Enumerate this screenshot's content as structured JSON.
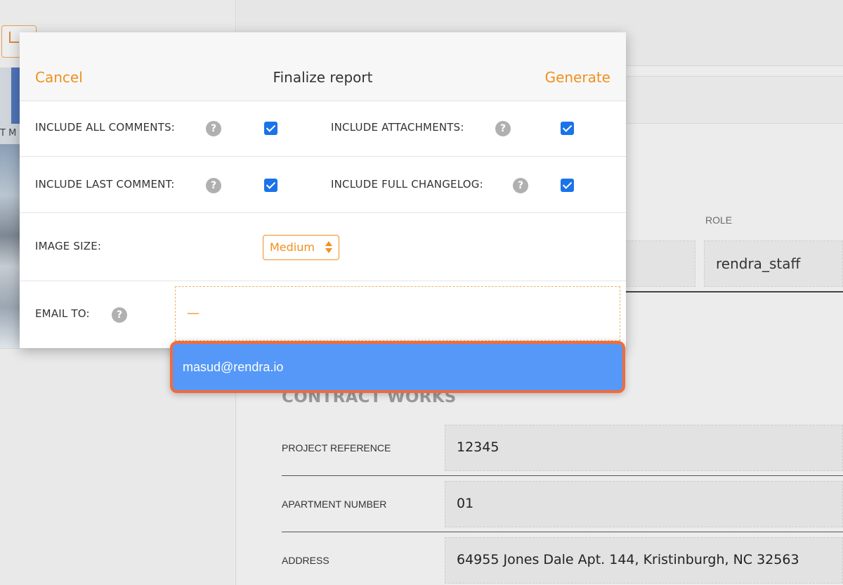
{
  "background": {
    "thumb_caption": "T M",
    "role": {
      "label": "ROLE",
      "value": "rendra_staff"
    },
    "section_title": "CONTRACT WORKS",
    "rows": [
      {
        "label": "PROJECT REFERENCE",
        "value": "12345"
      },
      {
        "label": "APARTMENT NUMBER",
        "value": "01"
      },
      {
        "label": "ADDRESS",
        "value": "64955 Jones Dale Apt. 144, Kristinburgh, NC 32563"
      }
    ]
  },
  "modal": {
    "title": "Finalize report",
    "cancel_label": "Cancel",
    "generate_label": "Generate",
    "options": {
      "include_all_comments": {
        "label": "INCLUDE ALL COMMENTS:",
        "checked": true
      },
      "include_attachments": {
        "label": "INCLUDE ATTACHMENTS:",
        "checked": true
      },
      "include_last_comment": {
        "label": "INCLUDE LAST COMMENT:",
        "checked": true
      },
      "include_full_changelog": {
        "label": "INCLUDE FULL CHANGELOG:",
        "checked": true
      }
    },
    "image_size": {
      "label": "IMAGE SIZE:",
      "selected": "Medium"
    },
    "email_to": {
      "label": "EMAIL TO:",
      "value": "—"
    },
    "help_glyph": "?"
  },
  "suggestions": [
    "masud@rendra.io"
  ],
  "colors": {
    "accent": "#f0901d",
    "checkbox": "#1a73e8",
    "suggestion_bg": "#5598f7",
    "highlight_outline": "#f26b3a"
  }
}
